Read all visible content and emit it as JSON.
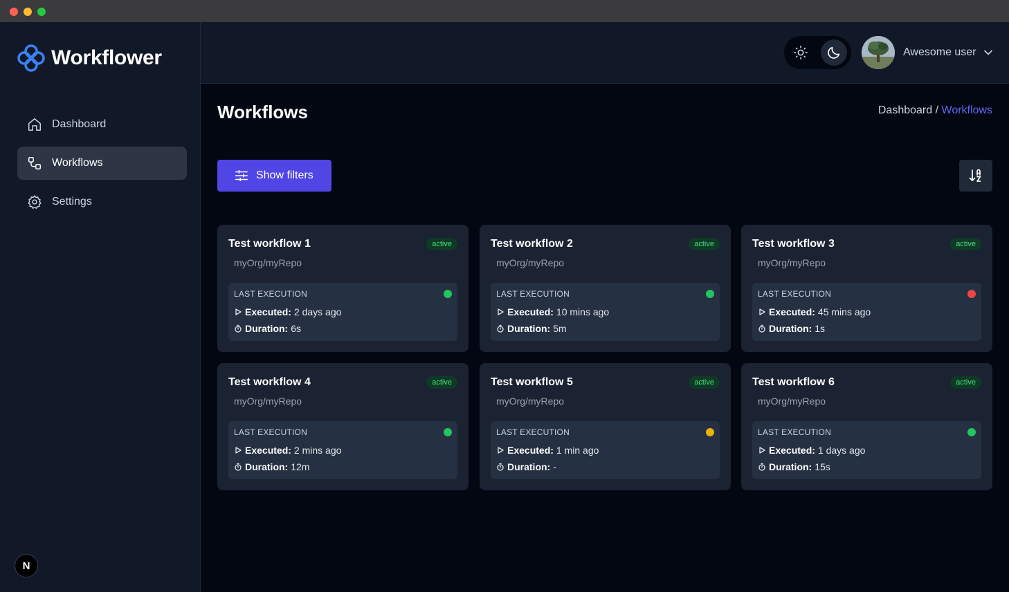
{
  "app": {
    "name": "Workflower"
  },
  "sidebar": {
    "items": [
      {
        "label": "Dashboard",
        "icon": "home-icon",
        "active": false
      },
      {
        "label": "Workflows",
        "icon": "workflow-icon",
        "active": true
      },
      {
        "label": "Settings",
        "icon": "gear-icon",
        "active": false
      }
    ],
    "badge": "N"
  },
  "header": {
    "user_name": "Awesome user",
    "theme_icons": [
      "sun-icon",
      "moon-icon"
    ]
  },
  "page": {
    "title": "Workflows",
    "breadcrumb": {
      "parent": "Dashboard /",
      "current": "Workflows"
    },
    "filters_label": "Show filters"
  },
  "workflows": [
    {
      "title": "Test workflow 1",
      "badge": "active",
      "repo": "myOrg/myRepo",
      "exec_label": "LAST EXECUTION",
      "executed_label": "Executed:",
      "executed": "2 days ago",
      "duration_label": "Duration:",
      "duration": "6s",
      "status_color": "#22c55e"
    },
    {
      "title": "Test workflow 2",
      "badge": "active",
      "repo": "myOrg/myRepo",
      "exec_label": "LAST EXECUTION",
      "executed_label": "Executed:",
      "executed": "10 mins ago",
      "duration_label": "Duration:",
      "duration": "5m",
      "status_color": "#22c55e"
    },
    {
      "title": "Test workflow 3",
      "badge": "active",
      "repo": "myOrg/myRepo",
      "exec_label": "LAST EXECUTION",
      "executed_label": "Executed:",
      "executed": "45 mins ago",
      "duration_label": "Duration:",
      "duration": "1s",
      "status_color": "#ef4444"
    },
    {
      "title": "Test workflow 4",
      "badge": "active",
      "repo": "myOrg/myRepo",
      "exec_label": "LAST EXECUTION",
      "executed_label": "Executed:",
      "executed": "2 mins ago",
      "duration_label": "Duration:",
      "duration": "12m",
      "status_color": "#22c55e"
    },
    {
      "title": "Test workflow 5",
      "badge": "active",
      "repo": "myOrg/myRepo",
      "exec_label": "LAST EXECUTION",
      "executed_label": "Executed:",
      "executed": "1 min ago",
      "duration_label": "Duration:",
      "duration": "-",
      "status_color": "#eab308"
    },
    {
      "title": "Test workflow 6",
      "badge": "active",
      "repo": "myOrg/myRepo",
      "exec_label": "LAST EXECUTION",
      "executed_label": "Executed:",
      "executed": "1 days ago",
      "duration_label": "Duration:",
      "duration": "15s",
      "status_color": "#22c55e"
    }
  ],
  "colors": {
    "accent": "#5046e5",
    "breadcrumb_active": "#6366f1",
    "badge_text": "#4ade80"
  }
}
